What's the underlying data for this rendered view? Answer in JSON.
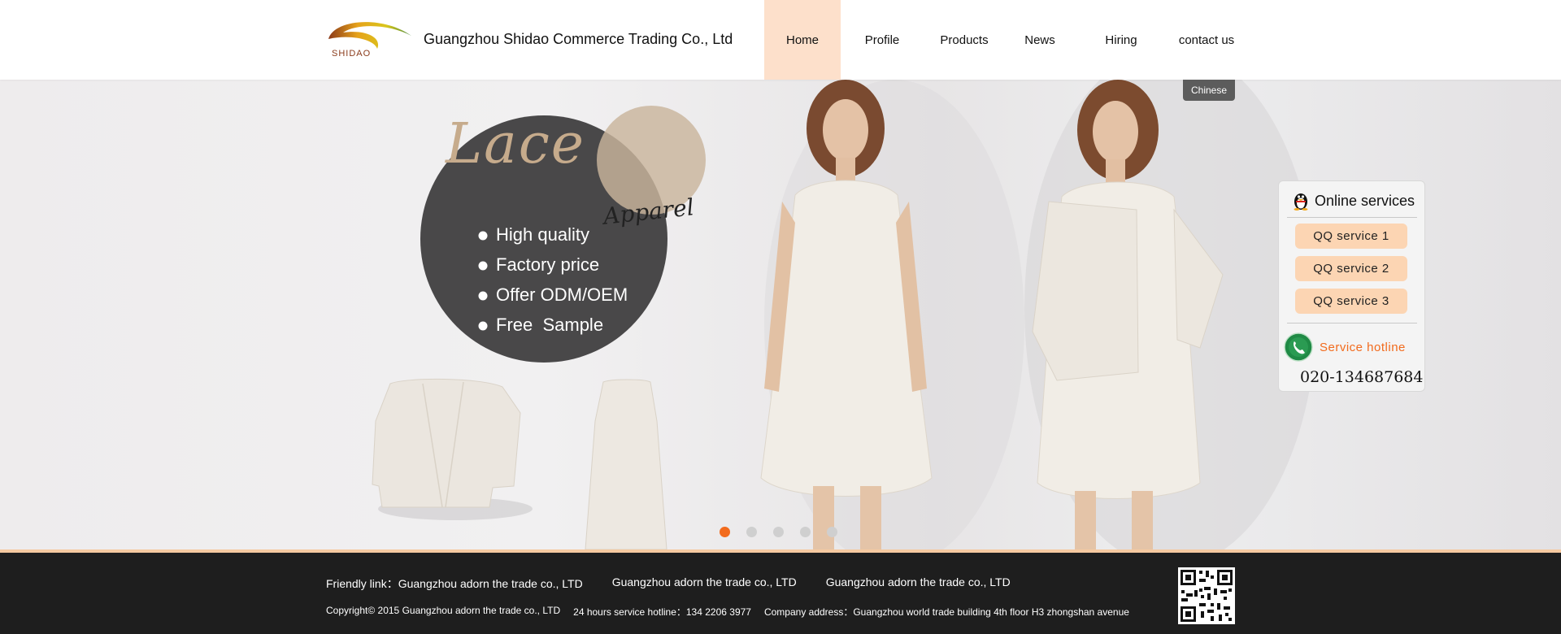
{
  "header": {
    "logo_text": "SHIDAO",
    "company_name": "Guangzhou Shidao Commerce Trading Co., Ltd",
    "nav": [
      {
        "label": "Home",
        "active": true
      },
      {
        "label": "Profile",
        "active": false
      },
      {
        "label": "Products",
        "active": false
      },
      {
        "label": "News",
        "active": false
      },
      {
        "label": "Hiring",
        "active": false
      },
      {
        "label": "contact us",
        "active": false
      }
    ],
    "language_button": "Chinese"
  },
  "banner": {
    "headline": "Lace",
    "sub_headline": "Apparel",
    "features": [
      "High quality",
      "Factory price",
      "Offer ODM/OEM",
      "Free  Sample"
    ],
    "slides_count": 5,
    "active_slide": 0
  },
  "online_services": {
    "title": "Online services",
    "qq_services": [
      "QQ service 1",
      "QQ service 2",
      "QQ service 3"
    ],
    "hotline_label": "Service hotline",
    "hotline_number": "020-134687684"
  },
  "footer": {
    "friendly_prefix": "Friendly link：",
    "friendly_links": [
      "Guangzhou adorn the trade co., LTD",
      "Guangzhou adorn the trade co., LTD",
      "Guangzhou adorn the trade co., LTD"
    ],
    "copyright": "Copyright© 2015 Guangzhou adorn the trade co., LTD",
    "service_hotline": "24 hours service hotline：134 2206 3977",
    "company_address": "Company address：Guangzhou world trade building 4th floor H3 zhongshan avenue"
  },
  "colors": {
    "accent_orange": "#f26b1d",
    "nav_active_bg": "#fde0cb",
    "qq_button_bg": "#fcd5b3",
    "footer_bg": "#1e1e1e",
    "circle_dark": "#494849",
    "circle_tan": "#c9b49c"
  }
}
